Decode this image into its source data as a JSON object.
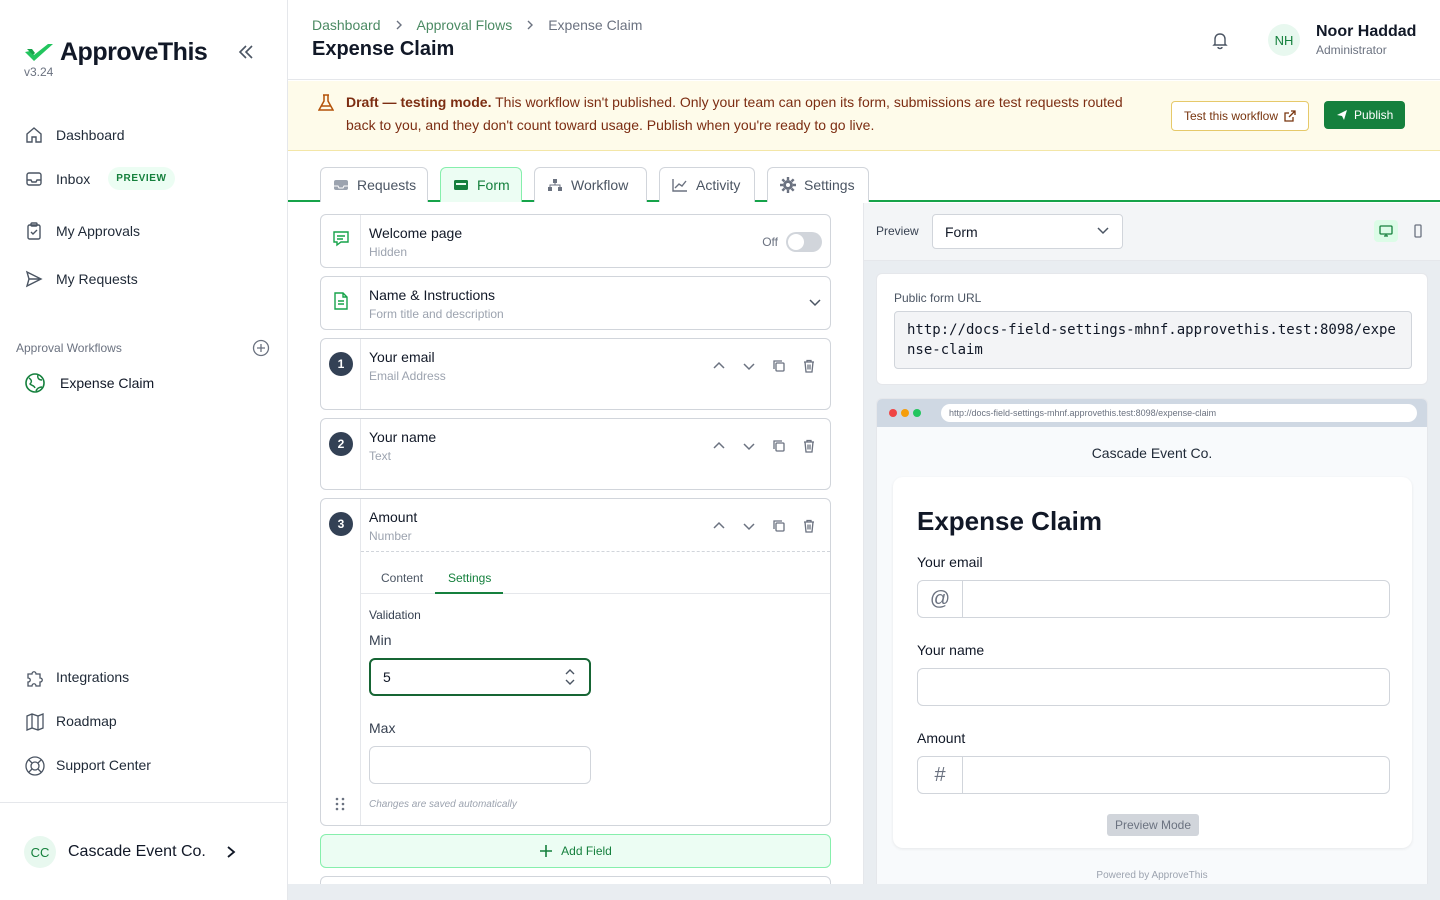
{
  "app": {
    "name": "ApproveThis",
    "version": "v3.24"
  },
  "sidebar": {
    "items": [
      {
        "label": "Dashboard"
      },
      {
        "label": "Inbox",
        "badge": "PREVIEW"
      },
      {
        "label": "My Approvals"
      },
      {
        "label": "My Requests"
      }
    ],
    "workflows_label": "Approval Workflows",
    "workflows": [
      {
        "label": "Expense Claim"
      }
    ],
    "bottom_items": [
      {
        "label": "Integrations"
      },
      {
        "label": "Roadmap"
      },
      {
        "label": "Support Center"
      }
    ],
    "org": {
      "initials": "CC",
      "name": "Cascade Event Co."
    }
  },
  "header": {
    "breadcrumb": [
      "Dashboard",
      "Approval Flows",
      "Expense Claim"
    ],
    "title": "Expense Claim",
    "user": {
      "initials": "NH",
      "name": "Noor Haddad",
      "role": "Administrator"
    }
  },
  "banner": {
    "strong": "Draft — testing mode.",
    "text": " This workflow isn't published. Only your team can open its form, submissions are test requests routed back to you, and they don't count toward usage. Publish when you're ready to go live.",
    "test_button": "Test this workflow",
    "publish_button": "Publish"
  },
  "tabs": [
    {
      "label": "Requests",
      "icon": "inbox-icon"
    },
    {
      "label": "Form",
      "icon": "form-icon"
    },
    {
      "label": "Workflow",
      "icon": "workflow-icon"
    },
    {
      "label": "Activity",
      "icon": "chart-icon"
    },
    {
      "label": "Settings",
      "icon": "gear-icon"
    }
  ],
  "form_builder": {
    "welcome": {
      "title": "Welcome page",
      "sub": "Hidden",
      "toggle_label": "Off"
    },
    "name_instructions": {
      "title": "Name & Instructions",
      "sub": "Form title and description"
    },
    "fields": [
      {
        "num": "1",
        "title": "Your email",
        "type": "Email Address"
      },
      {
        "num": "2",
        "title": "Your name",
        "type": "Text"
      },
      {
        "num": "3",
        "title": "Amount",
        "type": "Number"
      }
    ],
    "field_tabs": [
      "Content",
      "Settings"
    ],
    "validation_label": "Validation",
    "min_label": "Min",
    "min_value": "5",
    "max_label": "Max",
    "hint": "Changes are saved automatically",
    "add_field": "Add Field"
  },
  "preview": {
    "label": "Preview",
    "select_value": "Form",
    "url_label": "Public form URL",
    "url": "http://docs-field-settings-mhnf.approvethis.test:8098/expense-claim",
    "browser_url": "http://docs-field-settings-mhnf.approvethis.test:8098/expense-claim",
    "org_name": "Cascade Event Co.",
    "form_title": "Expense Claim",
    "fields": [
      "Your email",
      "Your name",
      "Amount"
    ],
    "preview_mode": "Preview Mode",
    "powered_by": "Powered by ApproveThis"
  },
  "colors": {
    "brand": "#15803d",
    "accent_light": "#ecfdf3",
    "banner_bg": "#fefbea"
  }
}
